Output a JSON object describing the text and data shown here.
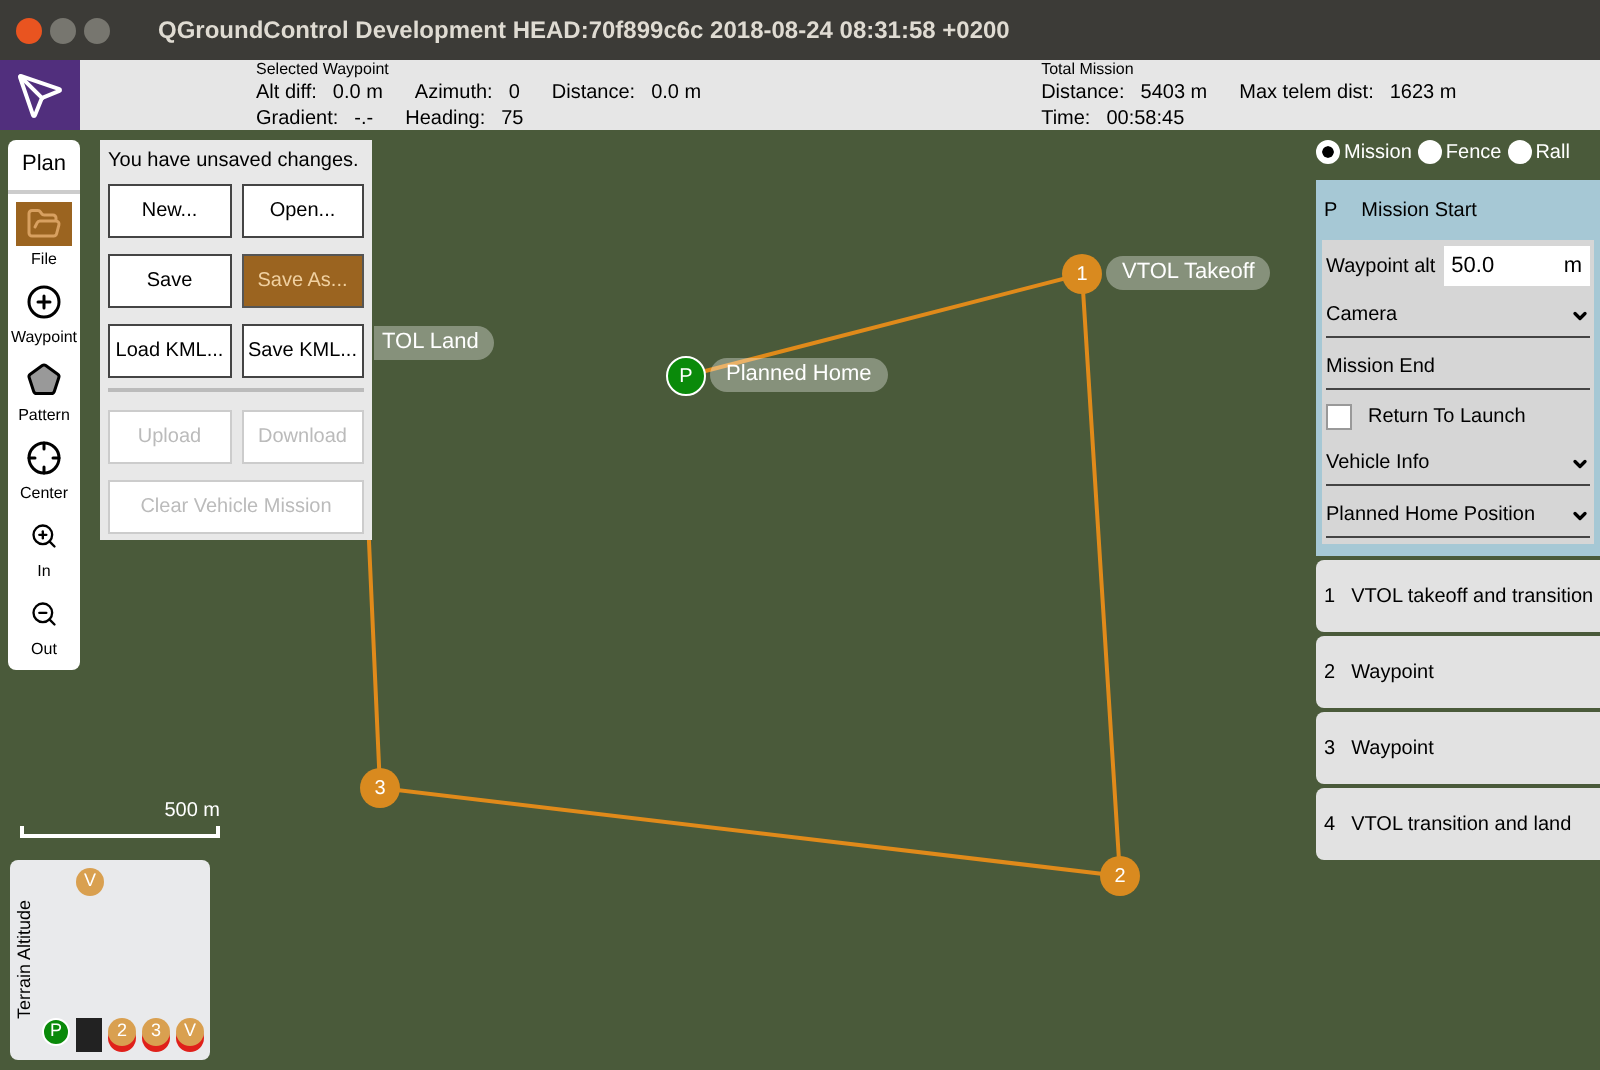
{
  "window": {
    "title": "QGroundControl Development HEAD:70f899c6c 2018-08-24 08:31:58 +0200"
  },
  "toolbar": {
    "selected_waypoint": {
      "heading": "Selected Waypoint",
      "rows": [
        [
          {
            "label": "Alt diff:",
            "value": "0.0 m"
          },
          {
            "label": "Azimuth:",
            "value": "0"
          },
          {
            "label": "Distance:",
            "value": "0.0 m"
          }
        ],
        [
          {
            "label": "Gradient:",
            "value": "-.-"
          },
          {
            "label": "Heading:",
            "value": "75"
          }
        ]
      ]
    },
    "total_mission": {
      "heading": "Total Mission",
      "rows": [
        [
          {
            "label": "Distance:",
            "value": "5403 m"
          },
          {
            "label": "Max telem dist:",
            "value": "1623 m"
          }
        ],
        [
          {
            "label": "Time:",
            "value": "00:58:45"
          }
        ]
      ]
    }
  },
  "plan_tools": {
    "title": "Plan",
    "items": [
      {
        "kind": "file",
        "label": "File",
        "selected": true
      },
      {
        "kind": "waypoint",
        "label": "Waypoint",
        "selected": false
      },
      {
        "kind": "pattern",
        "label": "Pattern",
        "selected": false
      },
      {
        "kind": "center",
        "label": "Center",
        "selected": false
      },
      {
        "kind": "zoom_in",
        "label": "In",
        "selected": false
      },
      {
        "kind": "zoom_out",
        "label": "Out",
        "selected": false
      }
    ]
  },
  "file_menu": {
    "message": "You have unsaved changes.",
    "buttons": [
      {
        "label": "New...",
        "selected": false,
        "disabled": false
      },
      {
        "label": "Open...",
        "selected": false,
        "disabled": false
      },
      {
        "label": "Save",
        "selected": false,
        "disabled": false
      },
      {
        "label": "Save As...",
        "selected": true,
        "disabled": false
      },
      {
        "label": "Load KML...",
        "selected": false,
        "disabled": false
      },
      {
        "label": "Save KML...",
        "selected": false,
        "disabled": false
      },
      {
        "label": "Upload",
        "selected": false,
        "disabled": true
      },
      {
        "label": "Download",
        "selected": false,
        "disabled": true
      },
      {
        "label": "Clear Vehicle Mission",
        "selected": false,
        "disabled": true
      }
    ]
  },
  "layers": [
    {
      "label": "Mission",
      "selected": true
    },
    {
      "label": "Fence",
      "selected": false
    },
    {
      "label": "Rall",
      "selected": false
    }
  ],
  "mission_start": {
    "marker": "P",
    "title": "Mission Start",
    "waypoint_alt": {
      "label": "Waypoint alt",
      "value": "50.0",
      "unit": "m"
    },
    "sections": [
      {
        "kind": "dropdown",
        "label": "Camera"
      },
      {
        "kind": "header",
        "label": "Mission End"
      },
      {
        "kind": "checkbox",
        "label": "Return To Launch",
        "checked": false
      },
      {
        "kind": "dropdown",
        "label": "Vehicle Info"
      },
      {
        "kind": "dropdown",
        "label": "Planned Home Position"
      }
    ]
  },
  "mission_items": [
    {
      "number": "1",
      "title": "VTOL takeoff and transition"
    },
    {
      "number": "2",
      "title": "Waypoint"
    },
    {
      "number": "3",
      "title": "Waypoint"
    },
    {
      "number": "4",
      "title": "VTOL transition and land"
    }
  ],
  "map": {
    "scale": "500 m",
    "markers": [
      {
        "kind": "home",
        "label": "P",
        "caption": "Planned Home"
      },
      {
        "kind": "waypoint",
        "label": "1",
        "caption": "VTOL Takeoff"
      },
      {
        "kind": "waypoint",
        "label": "2"
      },
      {
        "kind": "waypoint",
        "label": "3"
      }
    ],
    "hidden_caption": "TOL Land"
  },
  "terrain": {
    "title": "Terrain Altitude",
    "top_marker": "V",
    "markers": [
      {
        "kind": "home",
        "label": "P"
      },
      {
        "kind": "vehicle"
      },
      {
        "kind": "waypoint",
        "label": "2"
      },
      {
        "kind": "waypoint",
        "label": "3"
      },
      {
        "kind": "waypoint",
        "label": "V"
      }
    ]
  }
}
